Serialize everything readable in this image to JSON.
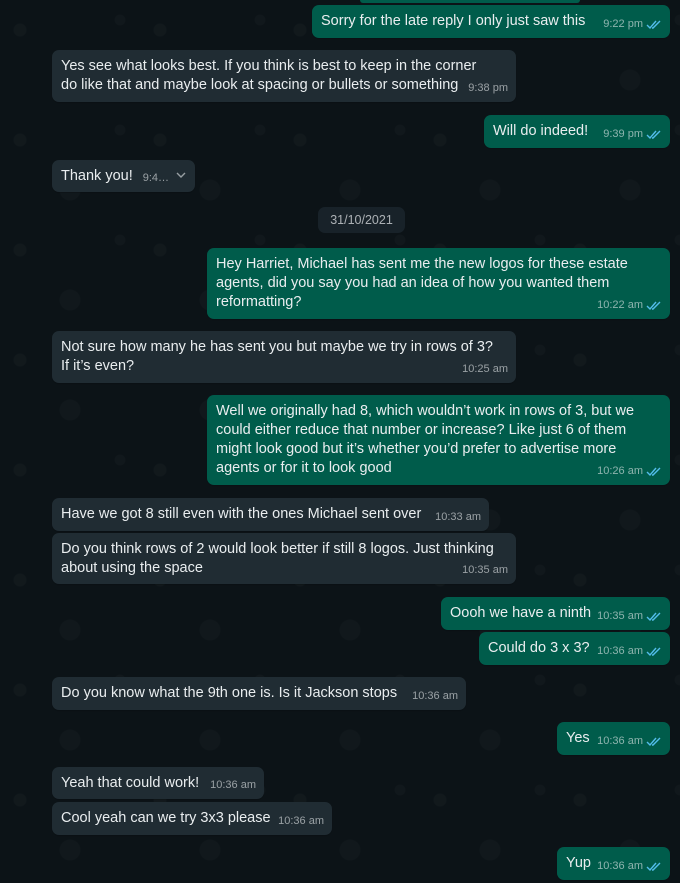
{
  "colors": {
    "background": "#0c1317",
    "incoming_bubble": "#202c33",
    "outgoing_bubble": "#005c4b",
    "read_ticks": "#53bdeb"
  },
  "date_divider": "31/10/2021",
  "messages": [
    {
      "dir": "out",
      "text": "Sorry for the late reply I only just saw this",
      "time": "9:22 pm"
    },
    {
      "dir": "in",
      "text": "Yes see what looks best. If you think is best to keep in the corner do like that and maybe look at spacing or bullets or something",
      "time": "9:38 pm"
    },
    {
      "dir": "out",
      "text": "Will do indeed!",
      "time": "9:39 pm"
    },
    {
      "dir": "in",
      "text": "Thank you!",
      "time": "9:4…"
    },
    {
      "dir": "out",
      "text": "Hey Harriet, Michael has sent me the new logos for these estate agents, did you say you had an idea of how you wanted them reformatting?",
      "time": "10:22 am"
    },
    {
      "dir": "in",
      "text": "Not sure how many he has sent you but maybe we try in rows of 3? If it’s even?",
      "time": "10:25 am"
    },
    {
      "dir": "out",
      "text": "Well we originally had 8, which wouldn’t work in rows of 3, but we could either reduce that number or increase? Like just 6 of them might look good but it’s whether you’d prefer to advertise more agents or for it to look good",
      "time": "10:26 am"
    },
    {
      "dir": "in",
      "text": "Have we got 8 still even with the ones Michael sent over",
      "time": "10:33 am"
    },
    {
      "dir": "in",
      "text": "Do you think rows of 2 would look better if still 8 logos. Just thinking about using the space",
      "time": "10:35 am"
    },
    {
      "dir": "out",
      "text": "Oooh we have a ninth",
      "time": "10:35 am"
    },
    {
      "dir": "out",
      "text": "Could do 3 x 3?",
      "time": "10:36 am"
    },
    {
      "dir": "in",
      "text": "Do you know what the 9th one is. Is it Jackson stops",
      "time": "10:36 am"
    },
    {
      "dir": "out",
      "text": "Yes",
      "time": "10:36 am"
    },
    {
      "dir": "in",
      "text": "Yeah that could work!",
      "time": "10:36 am"
    },
    {
      "dir": "in",
      "text": "Cool yeah can we try 3x3 please",
      "time": "10:36 am"
    },
    {
      "dir": "out",
      "text": "Yup",
      "time": "10:36 am"
    }
  ]
}
